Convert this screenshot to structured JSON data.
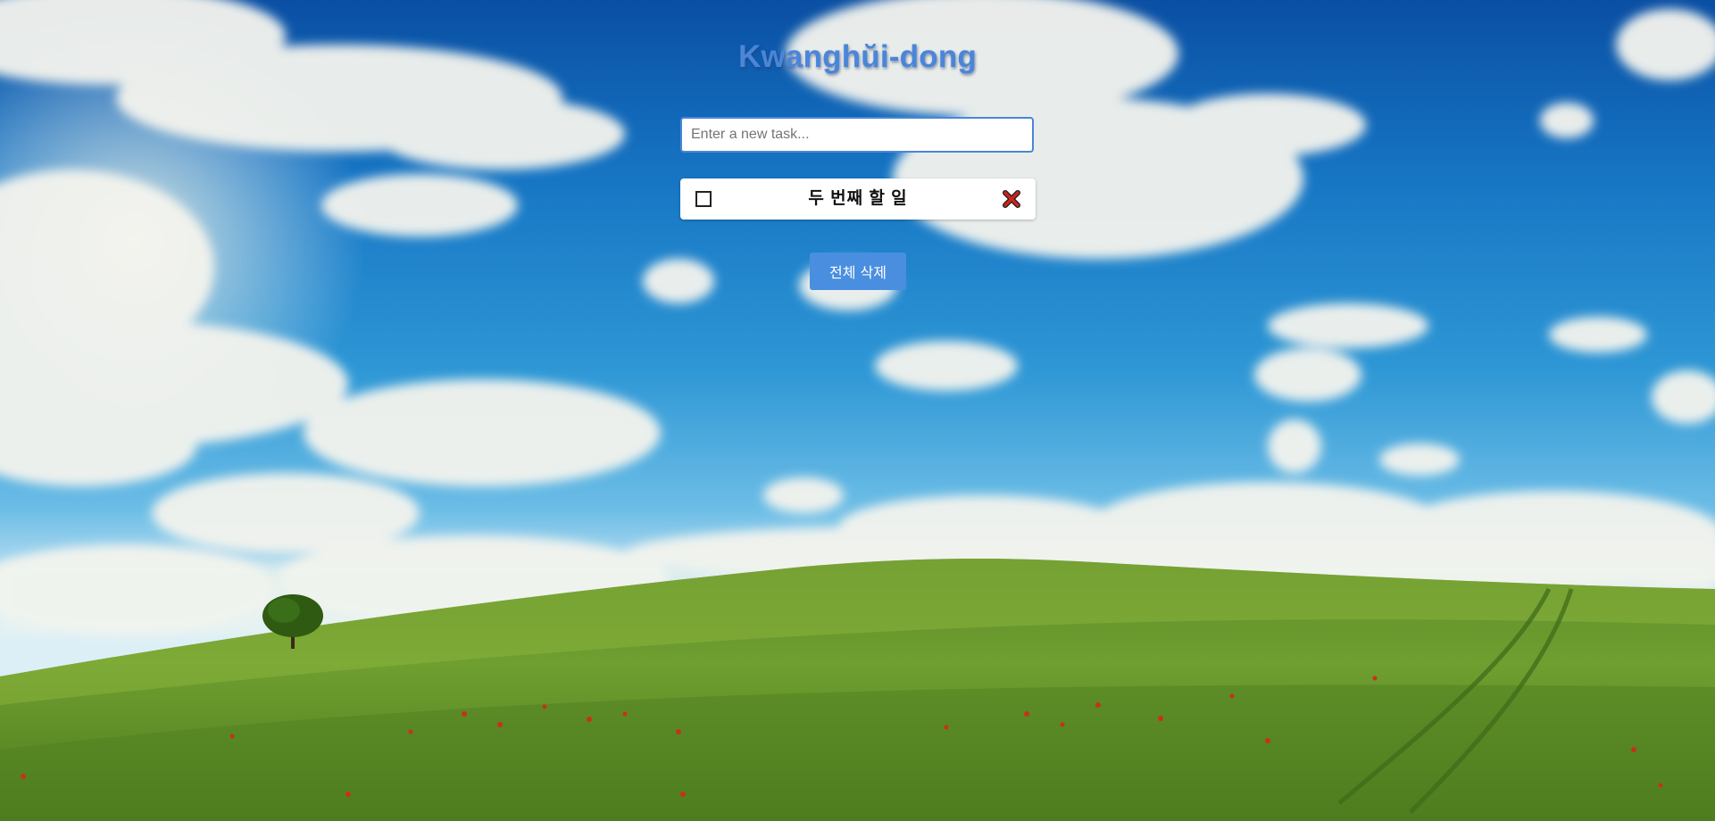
{
  "app": {
    "title": "Kwanghŭi-dong"
  },
  "input": {
    "value": "",
    "placeholder": "Enter a new task..."
  },
  "tasks": [
    {
      "text": "두 번째 할 일",
      "done": false
    }
  ],
  "actions": {
    "clear_all_label": "전체 삭제"
  },
  "background": {
    "scene": "cloud-sky-green-hill-wallpaper"
  },
  "colors": {
    "accent": "#4a86d8",
    "button": "#4a8ee0",
    "delete_icon": "#c8261e"
  },
  "icons": {
    "checkbox": "checkbox-unchecked-icon",
    "delete": "close-x-icon"
  }
}
